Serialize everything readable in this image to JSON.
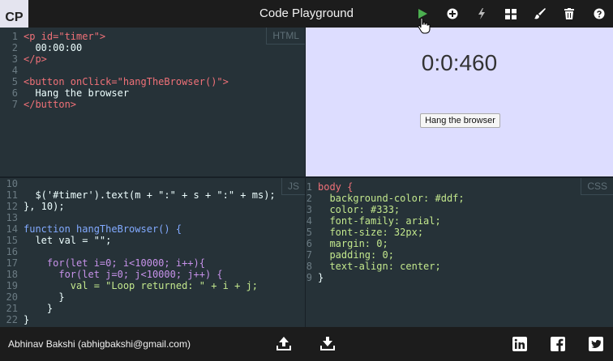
{
  "app": {
    "logo": "CP",
    "title": "Code Playground"
  },
  "toolbar": {
    "icons": [
      "play-icon",
      "add-icon",
      "bolt-icon",
      "grid-icon",
      "brush-icon",
      "trash-icon",
      "help-icon"
    ],
    "run_color": "#4caf50"
  },
  "html_pane": {
    "label": "HTML",
    "lines": [
      {
        "n": "1",
        "t": "<p id=\"timer\">"
      },
      {
        "n": "2",
        "t": "  00:00:00"
      },
      {
        "n": "3",
        "t": "</p>"
      },
      {
        "n": "4",
        "t": ""
      },
      {
        "n": "5",
        "t": "<button onClick=\"hangTheBrowser()\">"
      },
      {
        "n": "6",
        "t": "  Hang the browser"
      },
      {
        "n": "7",
        "t": "</button>"
      }
    ]
  },
  "preview": {
    "timer": "0:0:460",
    "button": "Hang the browser",
    "background": "#ddddff"
  },
  "js_pane": {
    "label": "JS",
    "lines": [
      {
        "n": "10",
        "t": ""
      },
      {
        "n": "11",
        "t": "  $('#timer').text(m + \":\" + s + \":\" + ms);"
      },
      {
        "n": "12",
        "t": "}, 10);"
      },
      {
        "n": "13",
        "t": ""
      },
      {
        "n": "14",
        "t": "function hangTheBrowser() {"
      },
      {
        "n": "15",
        "t": "  let val = \"\";"
      },
      {
        "n": "16",
        "t": ""
      },
      {
        "n": "17",
        "t": "    for(let i=0; i<10000; i++){"
      },
      {
        "n": "18",
        "t": "      for(let j=0; j<10000; j++) {"
      },
      {
        "n": "19",
        "t": "        val = \"Loop returned: \" + i + j;"
      },
      {
        "n": "20",
        "t": "      }"
      },
      {
        "n": "21",
        "t": "    }"
      },
      {
        "n": "22",
        "t": "}"
      }
    ]
  },
  "css_pane": {
    "label": "CSS",
    "lines": [
      {
        "n": "1",
        "t": "body {"
      },
      {
        "n": "2",
        "t": "  background-color: #ddf;"
      },
      {
        "n": "3",
        "t": "  color: #333;"
      },
      {
        "n": "4",
        "t": "  font-family: arial;"
      },
      {
        "n": "5",
        "t": "  font-size: 32px;"
      },
      {
        "n": "6",
        "t": "  margin: 0;"
      },
      {
        "n": "7",
        "t": "  padding: 0;"
      },
      {
        "n": "8",
        "t": "  text-align: center;"
      },
      {
        "n": "9",
        "t": "}"
      }
    ]
  },
  "footer": {
    "author": "Abhinav Bakshi (abhigbakshi@gmail.com)",
    "icons": [
      "upload-icon",
      "download-icon",
      "linkedin-icon",
      "facebook-icon",
      "twitter-icon"
    ]
  }
}
